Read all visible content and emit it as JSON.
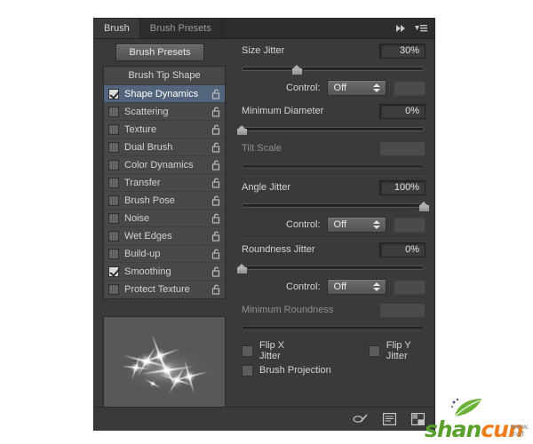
{
  "window": {
    "tabs": [
      {
        "label": "Brush",
        "active": true
      },
      {
        "label": "Brush Presets",
        "active": false
      }
    ],
    "collapse_icon": "double-right-arrow-icon",
    "menu_icon": "panel-menu-icon"
  },
  "toolbar": {
    "brush_presets_button": "Brush Presets"
  },
  "brush_options": {
    "header": "Brush Tip Shape",
    "items": [
      {
        "label": "Shape Dynamics",
        "checked": true,
        "selected": true,
        "locked": false
      },
      {
        "label": "Scattering",
        "checked": false,
        "selected": false,
        "locked": false
      },
      {
        "label": "Texture",
        "checked": false,
        "selected": false,
        "locked": false
      },
      {
        "label": "Dual Brush",
        "checked": false,
        "selected": false,
        "locked": false
      },
      {
        "label": "Color Dynamics",
        "checked": false,
        "selected": false,
        "locked": false
      },
      {
        "label": "Transfer",
        "checked": false,
        "selected": false,
        "locked": false
      },
      {
        "label": "Brush Pose",
        "checked": false,
        "selected": false,
        "locked": false
      },
      {
        "label": "Noise",
        "checked": false,
        "selected": false,
        "locked": false
      },
      {
        "label": "Wet Edges",
        "checked": false,
        "selected": false,
        "locked": false
      },
      {
        "label": "Build-up",
        "checked": false,
        "selected": false,
        "locked": false
      },
      {
        "label": "Smoothing",
        "checked": true,
        "selected": false,
        "locked": false
      },
      {
        "label": "Protect Texture",
        "checked": false,
        "selected": false,
        "locked": false
      }
    ]
  },
  "preview": {
    "name": "brush-stroke-preview",
    "description": "sparkle star brush stroke"
  },
  "settings": {
    "size_jitter": {
      "label": "Size Jitter",
      "value": "30%",
      "slider_percent": 30,
      "control_label": "Control:",
      "control_value": "Off"
    },
    "minimum_diameter": {
      "label": "Minimum Diameter",
      "value": "0%",
      "slider_percent": 0
    },
    "tilt_scale": {
      "label": "Tilt Scale",
      "value": "",
      "slider_percent": 0,
      "disabled": true
    },
    "angle_jitter": {
      "label": "Angle Jitter",
      "value": "100%",
      "slider_percent": 100,
      "control_label": "Control:",
      "control_value": "Off"
    },
    "roundness_jitter": {
      "label": "Roundness Jitter",
      "value": "0%",
      "slider_percent": 0,
      "control_label": "Control:",
      "control_value": "Off"
    },
    "minimum_roundness": {
      "label": "Minimum Roundness",
      "value": "",
      "slider_percent": 0,
      "disabled": true
    },
    "flip_x_jitter": {
      "label": "Flip X Jitter",
      "checked": false
    },
    "flip_y_jitter": {
      "label": "Flip Y Jitter",
      "checked": false
    },
    "brush_projection": {
      "label": "Brush Projection",
      "checked": false
    }
  },
  "bottom_bar": {
    "icons": [
      {
        "name": "toggle-brush-settings-icon"
      },
      {
        "name": "brush-preview-icon"
      },
      {
        "name": "new-brush-preset-icon"
      }
    ]
  },
  "watermark": {
    "text_a": "shan",
    "text_b": "cun",
    "domain_line1": "www.",
    "domain_line2": ".net"
  },
  "colors": {
    "panel_bg": "#3a3a3a",
    "tab_bg": "#2d2d2d",
    "list_bg": "#484848",
    "selection": "#53657d",
    "text": "#d4d4d4",
    "text_dim": "#8d8d8d",
    "watermark_green": "#5aa02c",
    "watermark_orange": "#ef7d1a"
  }
}
